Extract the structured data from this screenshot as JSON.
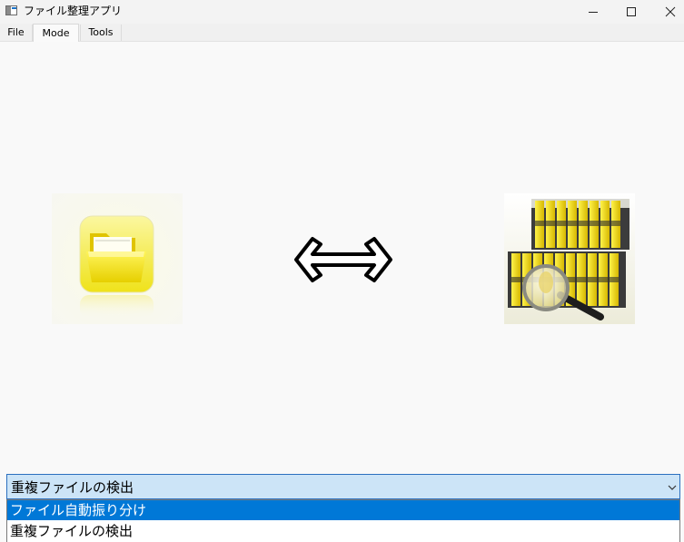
{
  "window": {
    "title": "ファイル整理アプリ"
  },
  "menu": {
    "tabs": [
      {
        "label": "File"
      },
      {
        "label": "Mode"
      },
      {
        "label": "Tools"
      }
    ],
    "active_tab": "Mode"
  },
  "content": {
    "left_image": "folder-icon",
    "center_symbol": "double-arrow-icon",
    "right_image": "file-archive-magnifier"
  },
  "mode_select": {
    "value": "重複ファイルの検出",
    "options": [
      {
        "label": "ファイル自動振り分け",
        "highlighted": true
      },
      {
        "label": "重複ファイルの検出",
        "highlighted": false
      }
    ]
  },
  "colors": {
    "accent": "#0078d7",
    "combo_background": "#cce4f7",
    "folder_yellow": "#f5e400"
  }
}
